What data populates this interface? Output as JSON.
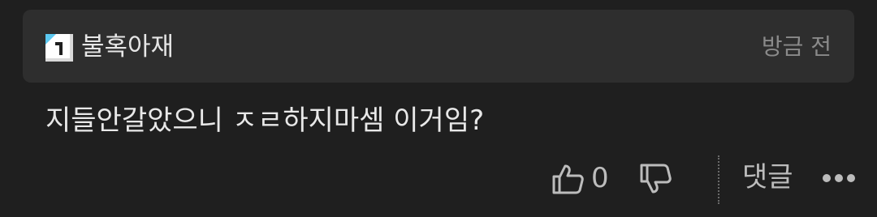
{
  "comment": {
    "author": "불혹아재",
    "timestamp": "방금 전",
    "text": "지들안갈았으니 ㅈㄹ하지마셈 이거임?",
    "likes": "0",
    "reply_label": "댓글"
  },
  "icons": {
    "level_badge": "level-1-badge-icon",
    "like": "thumbs-up-icon",
    "dislike": "thumbs-down-icon",
    "more": "more-dots-icon"
  },
  "colors": {
    "background": "#1f1f1f",
    "header_background": "#2e2e2e",
    "badge_accent": "#5bc8f0"
  }
}
